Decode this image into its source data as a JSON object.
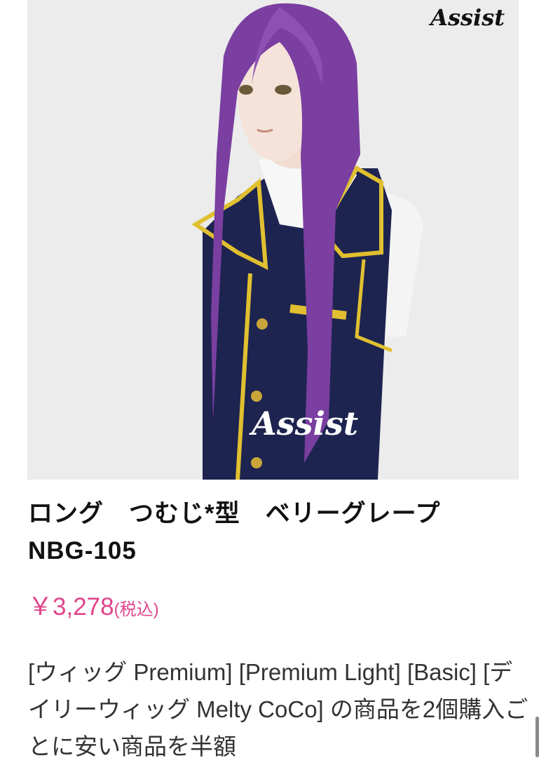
{
  "product": {
    "brand_logo": "Assist",
    "title": "ロング　つむじ*型　ベリーグレープ",
    "code": "NBG-105",
    "price": "￥3,278",
    "price_tax_note": "(税込)",
    "description": "[ウィッグ Premium] [Premium Light] [Basic] [デイリーウィッグ Melty CoCo] の商品を2個購入ごとに安い商品を半額"
  },
  "colors": {
    "price": "#e0458b",
    "wig": "#7a3fa0",
    "vest": "#1e2450",
    "trim": "#e0c030",
    "image_bg": "#ececec"
  }
}
